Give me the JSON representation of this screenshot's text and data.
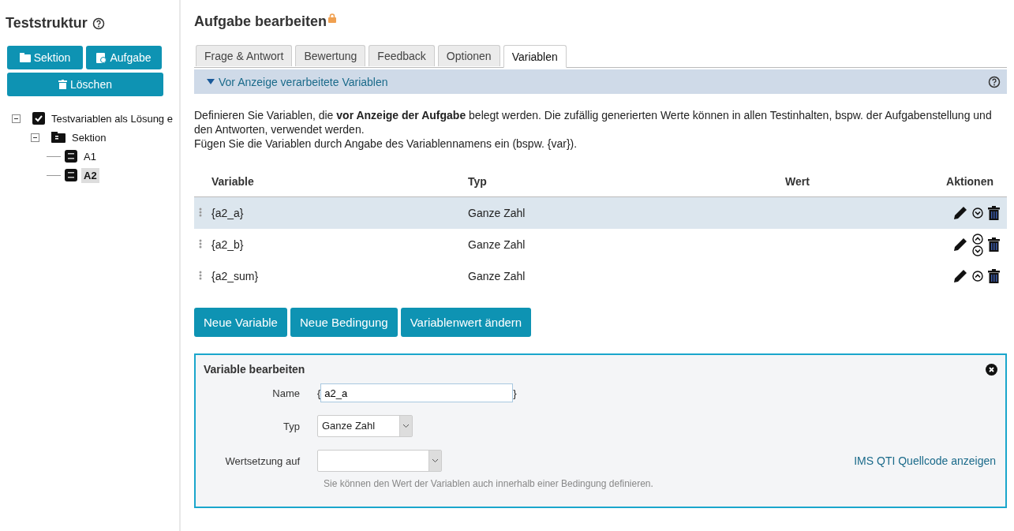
{
  "sidebar": {
    "title": "Teststruktur",
    "buttons": [
      {
        "label": "Sektion",
        "kind": "section"
      },
      {
        "label": "Aufgabe",
        "kind": "task"
      },
      {
        "label": "Löschen",
        "kind": "delete"
      }
    ],
    "tree": [
      {
        "label": "Testvariablen als Lösung e",
        "kind": "test",
        "expanded": true,
        "selected": false,
        "children": [
          {
            "label": "Sektion",
            "kind": "section",
            "expanded": true,
            "selected": false,
            "children": [
              {
                "label": "A1",
                "kind": "item",
                "selected": false
              },
              {
                "label": "A2",
                "kind": "item",
                "selected": true
              }
            ]
          }
        ]
      }
    ]
  },
  "main": {
    "title": "Aufgabe bearbeiten",
    "locked": true,
    "tabs": [
      {
        "label": "Frage & Antwort",
        "selected": false
      },
      {
        "label": "Bewertung",
        "selected": false
      },
      {
        "label": "Feedback",
        "selected": false
      },
      {
        "label": "Optionen",
        "selected": false
      },
      {
        "label": "Variablen",
        "selected": true
      }
    ],
    "panel": {
      "title": "Vor Anzeige verarbeitete Variablen",
      "expanded": true
    },
    "description": [
      "Definieren Sie Variablen, die **vor Anzeige der Aufgabe** belegt werden. Die zufällig generierten Werte können in allen Testinhalten, bspw. der Aufgabenstellung und den Antworten, verwendet werden.",
      "Fügen Sie die Variablen durch Angabe des Variablennamens ein (bspw. {var})."
    ],
    "table": {
      "columns": [
        "Variable",
        "Typ",
        "Wert",
        "Aktionen"
      ],
      "rows": [
        {
          "variable": "{a2_a}",
          "type": "Ganze Zahl",
          "selected": true,
          "up": false,
          "down": true
        },
        {
          "variable": "{a2_b}",
          "type": "Ganze Zahl",
          "selected": false,
          "up": true,
          "down": true
        },
        {
          "variable": "{a2_sum}",
          "type": "Ganze Zahl",
          "selected": false,
          "up": true,
          "down": false
        }
      ]
    },
    "buttons": [
      "Neue Variable",
      "Neue Bedingung",
      "Variablenwert ändern"
    ],
    "editor": {
      "title": "Variable bearbeiten",
      "name_label": "Name",
      "brace_open": "{",
      "name_value": "a2_a",
      "brace_close": "}",
      "type_label": "Typ",
      "type_value": "Ganze Zahl",
      "assign_label": "Wertsetzung auf",
      "hint": "Sie können den Wert der Variablen auch innerhalb einer Bedingung definieren.",
      "link": "IMS QTI Quellcode anzeigen"
    }
  }
}
